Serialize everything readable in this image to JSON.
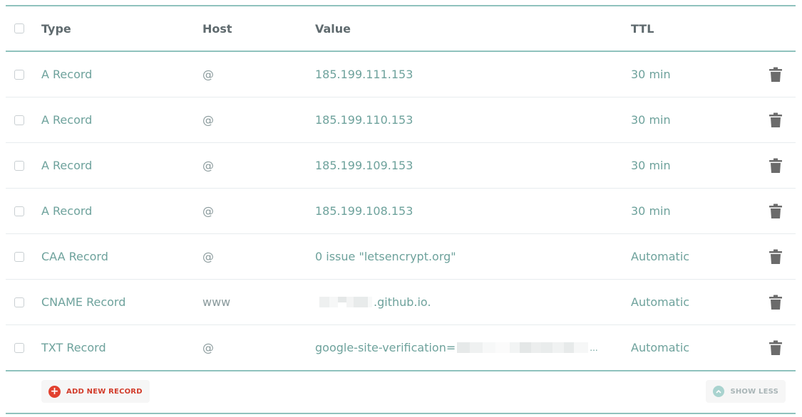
{
  "header": {
    "type": "Type",
    "host": "Host",
    "value": "Value",
    "ttl": "TTL"
  },
  "rows": [
    {
      "type": "A Record",
      "host": "@",
      "value": "185.199.111.153",
      "ttl": "30 min"
    },
    {
      "type": "A Record",
      "host": "@",
      "value": "185.199.110.153",
      "ttl": "30 min"
    },
    {
      "type": "A Record",
      "host": "@",
      "value": "185.199.109.153",
      "ttl": "30 min"
    },
    {
      "type": "A Record",
      "host": "@",
      "value": "185.199.108.153",
      "ttl": "30 min"
    },
    {
      "type": "CAA Record",
      "host": "@",
      "value": "0 issue \"letsencrypt.org\"",
      "ttl": "Automatic"
    },
    {
      "type": "CNAME Record",
      "host": "www",
      "value_suffix": ".github.io.",
      "ttl": "Automatic"
    },
    {
      "type": "TXT Record",
      "host": "@",
      "value_prefix": "google-site-verification=",
      "value_suffix": "...",
      "ttl": "Automatic"
    }
  ],
  "footer": {
    "add_label": "ADD NEW RECORD",
    "show_less_label": "SHOW LESS"
  },
  "icons": {
    "row_action": "trash-icon",
    "add": "plus-circle-icon",
    "show_less": "chevron-up-icon"
  },
  "colors": {
    "accent_line": "#8fc2bd",
    "record_text": "#6ea29c",
    "add_red": "#e2412f",
    "trash": "#6b6b6b"
  }
}
